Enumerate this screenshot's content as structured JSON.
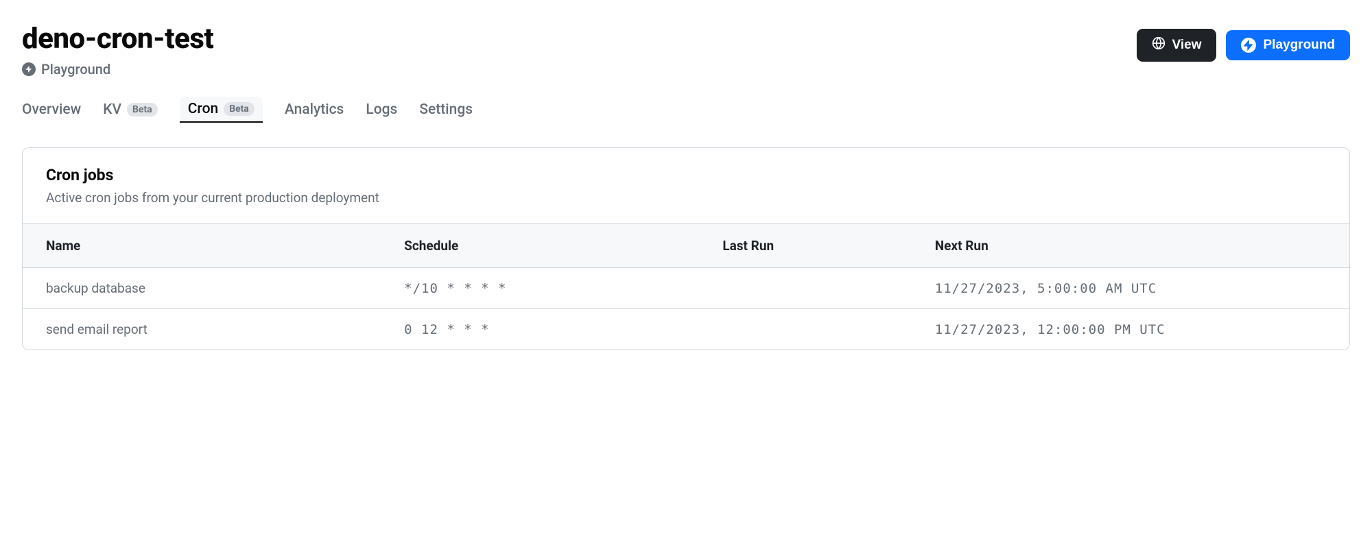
{
  "header": {
    "title": "deno-cron-test",
    "subtitle": "Playground"
  },
  "actions": {
    "view": "View",
    "playground": "Playground"
  },
  "tabs": [
    {
      "label": "Overview",
      "badge": null,
      "active": false
    },
    {
      "label": "KV",
      "badge": "Beta",
      "active": false
    },
    {
      "label": "Cron",
      "badge": "Beta",
      "active": true
    },
    {
      "label": "Analytics",
      "badge": null,
      "active": false
    },
    {
      "label": "Logs",
      "badge": null,
      "active": false
    },
    {
      "label": "Settings",
      "badge": null,
      "active": false
    }
  ],
  "panel": {
    "title": "Cron jobs",
    "description": "Active cron jobs from your current production deployment"
  },
  "table": {
    "columns": [
      "Name",
      "Schedule",
      "Last Run",
      "Next Run"
    ],
    "rows": [
      {
        "name": "backup database",
        "schedule": "*/10 * * * *",
        "last_run": "",
        "next_run": "11/27/2023, 5:00:00 AM UTC"
      },
      {
        "name": "send email report",
        "schedule": "0 12 * * *",
        "last_run": "",
        "next_run": "11/27/2023, 12:00:00 PM UTC"
      }
    ]
  }
}
